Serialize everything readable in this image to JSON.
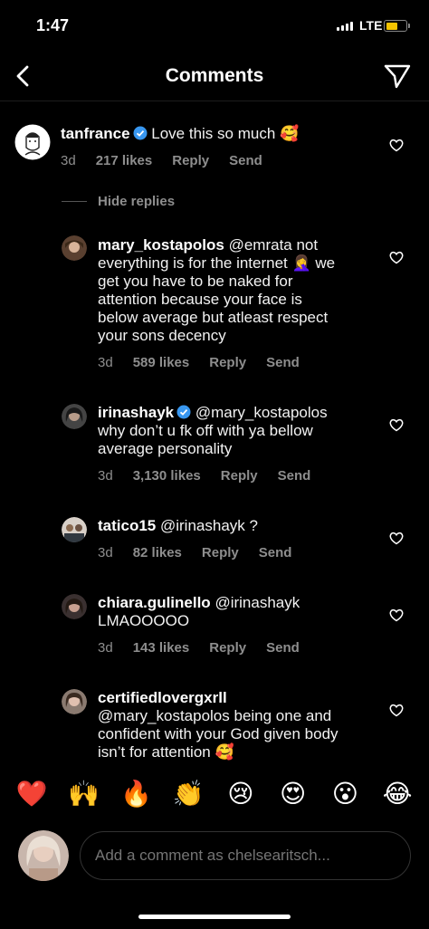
{
  "status": {
    "time": "1:47",
    "network": "LTE"
  },
  "header": {
    "title": "Comments"
  },
  "comments": [
    {
      "username": "tanfrance",
      "verified": true,
      "text": " Love this so much 🥰",
      "age": "3d",
      "likes": "217 likes",
      "reply": "Reply",
      "send": "Send"
    }
  ],
  "hide_replies": "Hide replies",
  "replies": [
    {
      "username": "mary_kostapolos",
      "verified": false,
      "lines": [
        "@emrata not",
        "everything is for the internet 🤦‍♀️ we",
        "get you have to be naked for",
        "attention because your face is",
        "below average but atleast respect",
        "your sons decency"
      ],
      "age": "3d",
      "likes": "589 likes",
      "reply": "Reply",
      "send": "Send"
    },
    {
      "username": "irinashayk",
      "verified": true,
      "lines": [
        "@mary_kostapolos",
        "why don’t u fk off with ya bellow",
        "average personality"
      ],
      "age": "3d",
      "likes": "3,130 likes",
      "reply": "Reply",
      "send": "Send"
    },
    {
      "username": "tatico15",
      "verified": false,
      "lines": [
        "@irinashayk ?"
      ],
      "age": "3d",
      "likes": "82 likes",
      "reply": "Reply",
      "send": "Send"
    },
    {
      "username": "chiara.gulinello",
      "verified": false,
      "lines": [
        "@irinashayk",
        "LMAOOOOO"
      ],
      "age": "3d",
      "likes": "143 likes",
      "reply": "Reply",
      "send": "Send"
    },
    {
      "username": "certifiedlovergxrll",
      "verified": false,
      "lines": [
        "",
        "@mary_kostapolos being one and",
        "confident with your God given body",
        "isn’t for attention 🥰"
      ],
      "age": "",
      "likes": "",
      "reply": "",
      "send": ""
    }
  ],
  "reactions": [
    "❤️",
    "🙌",
    "🔥",
    "👏",
    "😢",
    "😍",
    "😮",
    "😂"
  ],
  "comment_input": {
    "placeholder": "Add a comment as chelsearitsch..."
  },
  "colors": {
    "background": "#000000",
    "secondary_text": "#8e8e8e",
    "verified": "#3897f0",
    "battery": "#f5c400"
  }
}
